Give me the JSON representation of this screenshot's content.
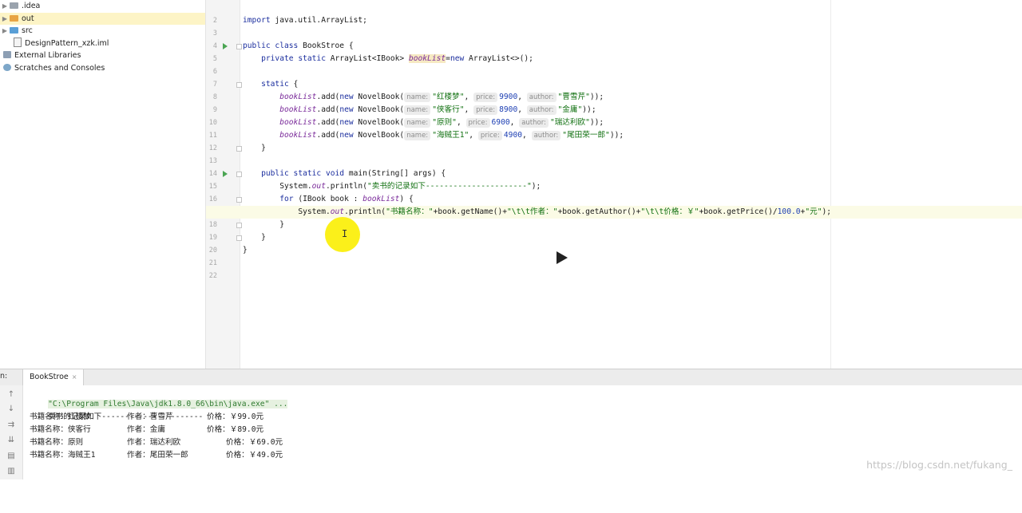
{
  "project_tree": [
    {
      "label": ".idea",
      "icon": "folder-gray"
    },
    {
      "label": "out",
      "icon": "folder-orange"
    },
    {
      "label": "src",
      "icon": "folder-blue"
    },
    {
      "label": "DesignPattern_xzk.iml",
      "icon": "module-file"
    },
    {
      "label": "External Libraries",
      "icon": "library"
    },
    {
      "label": "Scratches and Consoles",
      "icon": "scratch"
    }
  ],
  "editor": {
    "line_numbers": [
      "2",
      "3",
      "4",
      "5",
      "6",
      "7",
      "8",
      "9",
      "10",
      "11",
      "12",
      "13",
      "14",
      "15",
      "16",
      "17",
      "18",
      "19",
      "20",
      "21",
      "22"
    ],
    "import_kw": "import",
    "import_rest": " java.util.ArrayList;",
    "class_kw": "public class",
    "class_name": " BookStroe {",
    "field_kw": "private static",
    "field_type": " ArrayList<IBook> ",
    "field_name": "bookList",
    "field_eq": "=",
    "field_new": "new",
    "field_rest": " ArrayList<>();",
    "static_kw": "static",
    "static_rest": " {",
    "book_calls": [
      {
        "name": "\"红楼梦\"",
        "price": "9900",
        "author": "\"曹雪芹\""
      },
      {
        "name": "\"侠客行\"",
        "price": "8900",
        "author": "\"金庸\""
      },
      {
        "name": "\"原则\"",
        "price": "6900",
        "author": "\"瑞达利欧\""
      },
      {
        "name": "\"海贼王1\"",
        "price": "4900",
        "author": "\"尾田荣一郎\""
      }
    ],
    "call_prefix": ".add(",
    "call_new": "new",
    "call_class": " NovelBook(",
    "hint_name": "name:",
    "hint_price": "price:",
    "hint_author": "author:",
    "call_end": "));",
    "close_brace": "}",
    "main_kw": "public static void",
    "main_rest": " main(String[] args) {",
    "print_obj": "System.",
    "print_out": "out",
    "print_fn": ".println(",
    "print1_str": "\"卖书的记录如下----------------------\"",
    "stmt_end": ");",
    "for_kw": "for",
    "for_rest": " (IBook book : ",
    "for_end": ") {",
    "print2_s1": "\"书籍名称：\"",
    "print2_a": "+book.getName()+",
    "print2_s2": "\"\\t\\t作者：\"",
    "print2_b": "+book.getAuthor()+",
    "print2_s3": "\"\\t\\t价格：￥\"",
    "print2_c": "+book.getPrice()/",
    "print2_num": "100.0",
    "print2_plus": "+",
    "print2_s4": "\"元\"",
    "caret": "I"
  },
  "run_panel": {
    "run_label": "n:",
    "tab_label": "BookStroe",
    "tab_close": "×",
    "command": "\"C:\\Program Files\\Java\\jdk1.8.0_66\\bin\\java.exe\" ...",
    "header": "卖书的记录如下----------------------",
    "rows": [
      {
        "name": "书籍名称：红楼梦",
        "author": "作者：曹雪芹",
        "price": "价格：￥99.0元"
      },
      {
        "name": "书籍名称：侠客行",
        "author": "作者：金庸",
        "price": "价格：￥89.0元"
      },
      {
        "name": "书籍名称：原则",
        "author": "作者：瑞达利欧",
        "price": "价格：￥69.0元"
      },
      {
        "name": "书籍名称：海贼王1",
        "author": "作者：尾田荣一郎",
        "price": "价格：￥49.0元"
      }
    ]
  },
  "watermark": "https://blog.csdn.net/fukang_",
  "icons": {
    "run_gutter": "run-triangle-icon",
    "play_overlay": "play-icon",
    "toolbar": [
      "arrow-up-icon",
      "arrow-down-icon",
      "soft-wrap-icon",
      "scroll-end-icon",
      "print-icon",
      "trash-icon"
    ]
  },
  "colors": {
    "keyword": "#1b2e9e",
    "string": "#107010",
    "number": "#1d3fb3",
    "static_field": "#7a2b9a",
    "cursor_highlight": "#fbf01a",
    "selected_tree_row": "#fdf4c6"
  }
}
